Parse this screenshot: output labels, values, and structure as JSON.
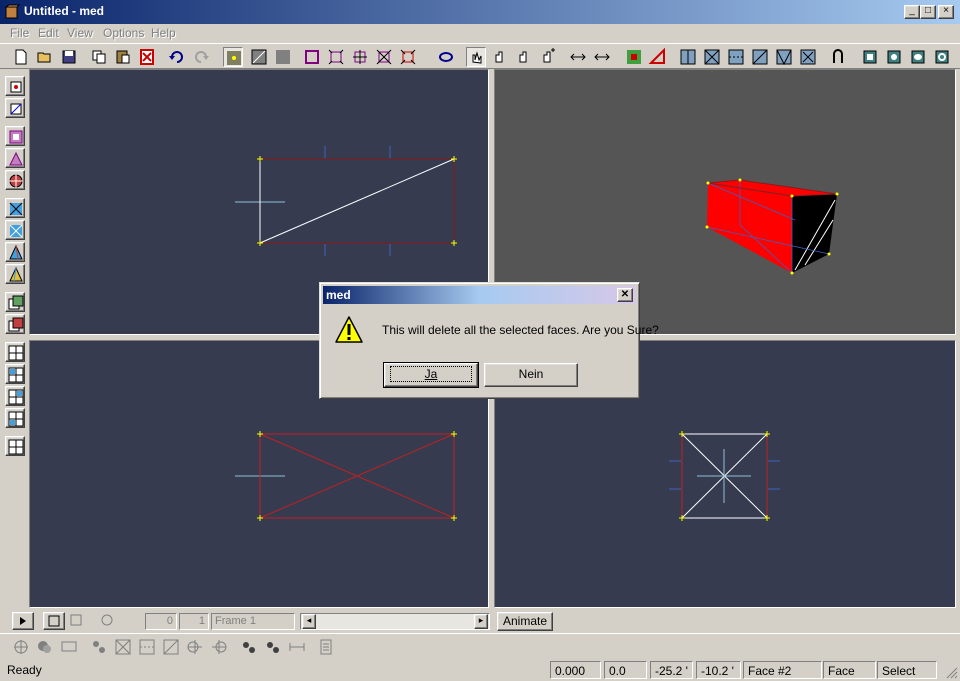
{
  "window": {
    "title": "Untitled - med",
    "minimize": "_",
    "maximize": "□",
    "close": "×"
  },
  "menu": [
    "File",
    "Edit",
    "View",
    "Options",
    "Help"
  ],
  "toolbar_icons": [
    "new-icon",
    "open-icon",
    "save-icon",
    "copy-icon",
    "paste-icon",
    "delete-icon",
    "undo-icon",
    "redo-icon",
    "vertex-mode-icon",
    "face-mode-icon",
    "object-mode-icon",
    "select-icon",
    "move-icon",
    "rotate-icon",
    "scale-icon",
    "orbit-icon",
    "pan-icon",
    "zoom-icon",
    "zoom-in-icon",
    "fit-icon",
    "mirror-icon",
    "add-vertex-icon",
    "add-face-icon",
    "grid-icon",
    "snap-icon",
    "shade-icon",
    "view-top-icon",
    "view-front-icon",
    "view-side-icon",
    "view-persp-icon",
    "extrude-icon",
    "cube-icon",
    "sphere-icon",
    "cylinder-icon",
    "torus-icon"
  ],
  "left_icons": [
    "select-vertex-icon",
    "select-face-icon",
    "draw-box-icon",
    "draw-triangle-icon",
    "target-icon",
    "flip-icon",
    "split-icon",
    "cone-icon",
    "pyramid-icon",
    "group-icon",
    "ungroup-icon",
    "layout-1-icon",
    "layout-2-icon",
    "layout-3-icon",
    "layout-4-icon",
    "layout-single-icon"
  ],
  "animbar": {
    "frame_start": "0",
    "frame_end": "1",
    "frame_name": "Frame 1",
    "animate_label": "Animate"
  },
  "status": {
    "text": "Ready",
    "x": "0.000",
    "y": "0.0",
    "coord_a": "-25.2 '",
    "coord_b": "-10.2 '",
    "face": "Face #2",
    "mode": "Face",
    "tool": "Select"
  },
  "dialog": {
    "title": "med",
    "message": "This will delete all the selected faces. Are you Sure?",
    "yes": "Ja",
    "no": "Nein",
    "icon": "warning-icon"
  },
  "colors": {
    "viewport_bg": "#363b50",
    "persp_bg": "#555555",
    "face_red": "#ff0000",
    "edge_red": "#8b1a1a",
    "vertex_yellow": "#ffff00"
  }
}
